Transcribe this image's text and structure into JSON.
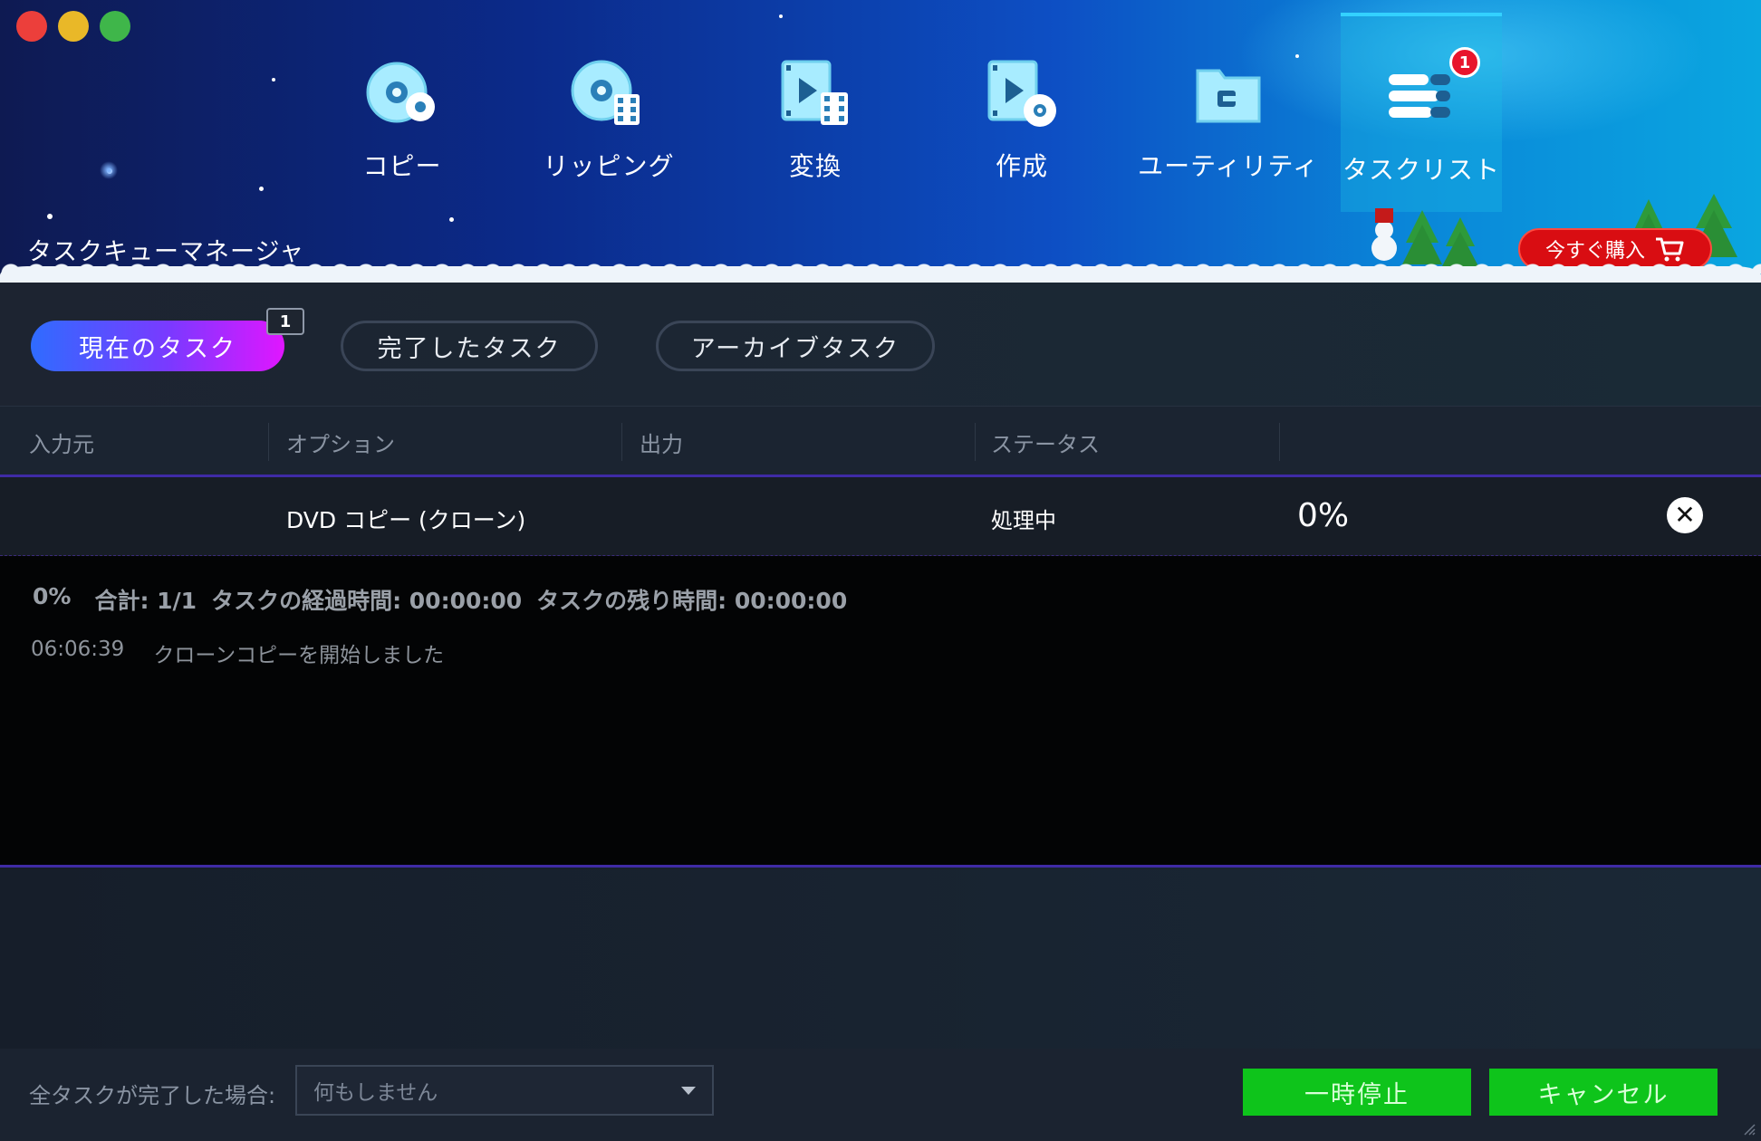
{
  "window": {
    "title": "タスクキューマネージャ"
  },
  "nav": {
    "items": [
      {
        "label": "コピー",
        "icon": "disc-copy-icon"
      },
      {
        "label": "リッピング",
        "icon": "disc-ripping-icon"
      },
      {
        "label": "変換",
        "icon": "video-convert-icon"
      },
      {
        "label": "作成",
        "icon": "video-create-icon"
      },
      {
        "label": "ユーティリティ",
        "icon": "toolbox-icon"
      },
      {
        "label": "タスクリスト",
        "icon": "task-list-icon",
        "badge": "1",
        "active": true
      }
    ]
  },
  "buy": {
    "label": "今すぐ購入",
    "icon": "cart-icon"
  },
  "tabs": {
    "current": "現在のタスク",
    "current_count": "1",
    "done": "完了したタスク",
    "archive": "アーカイブタスク"
  },
  "table": {
    "columns": [
      "入力元",
      "オプション",
      "出力",
      "ステータス"
    ],
    "rows": [
      {
        "source": "",
        "option": "DVD コピー (クローン)",
        "output": "",
        "status": "処理中",
        "progress": "0%"
      }
    ]
  },
  "log": {
    "percent": "0%",
    "total": "合計: 1/1",
    "elapsed": "タスクの経過時間: 00:00:00",
    "remaining": "タスクの残り時間: 00:00:00",
    "entries": [
      {
        "time": "06:06:39",
        "message": "クローンコピーを開始しました"
      }
    ]
  },
  "footer": {
    "on_complete_label": "全タスクが完了した場合:",
    "on_complete_value": "何もしません",
    "pause": "一時停止",
    "cancel": "キャンセル"
  },
  "colors": {
    "accent_green": "#0ec41b",
    "buy_red": "#d90d12",
    "tab_gradient_start": "#2f6cff",
    "tab_gradient_end": "#e016ff"
  }
}
